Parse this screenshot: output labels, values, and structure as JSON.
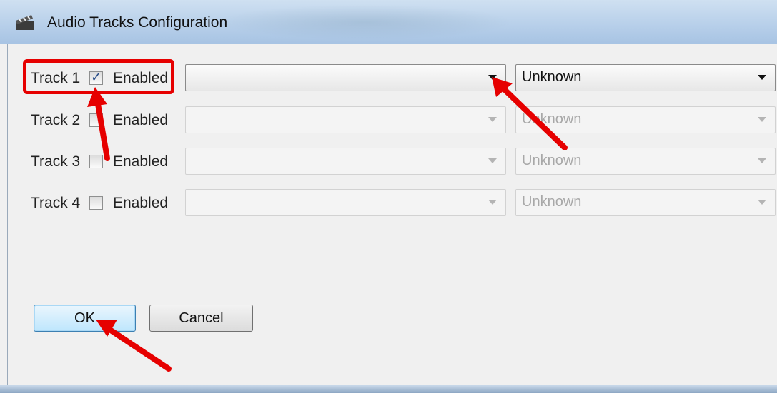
{
  "window": {
    "title": "Audio Tracks Configuration",
    "icon": "clapperboard-icon"
  },
  "tracks": [
    {
      "label": "Track 1",
      "enabled_label": "Enabled",
      "checked": true,
      "source": "",
      "language": "Unknown",
      "active": true
    },
    {
      "label": "Track 2",
      "enabled_label": "Enabled",
      "checked": false,
      "source": "",
      "language": "Unknown",
      "active": false
    },
    {
      "label": "Track 3",
      "enabled_label": "Enabled",
      "checked": false,
      "source": "",
      "language": "Unknown",
      "active": false
    },
    {
      "label": "Track 4",
      "enabled_label": "Enabled",
      "checked": false,
      "source": "",
      "language": "Unknown",
      "active": false
    }
  ],
  "buttons": {
    "ok": "OK",
    "cancel": "Cancel"
  },
  "colors": {
    "annotation": "#e60000",
    "titlebar": "#b8d0ea",
    "ok_border": "#3c7fb1"
  }
}
